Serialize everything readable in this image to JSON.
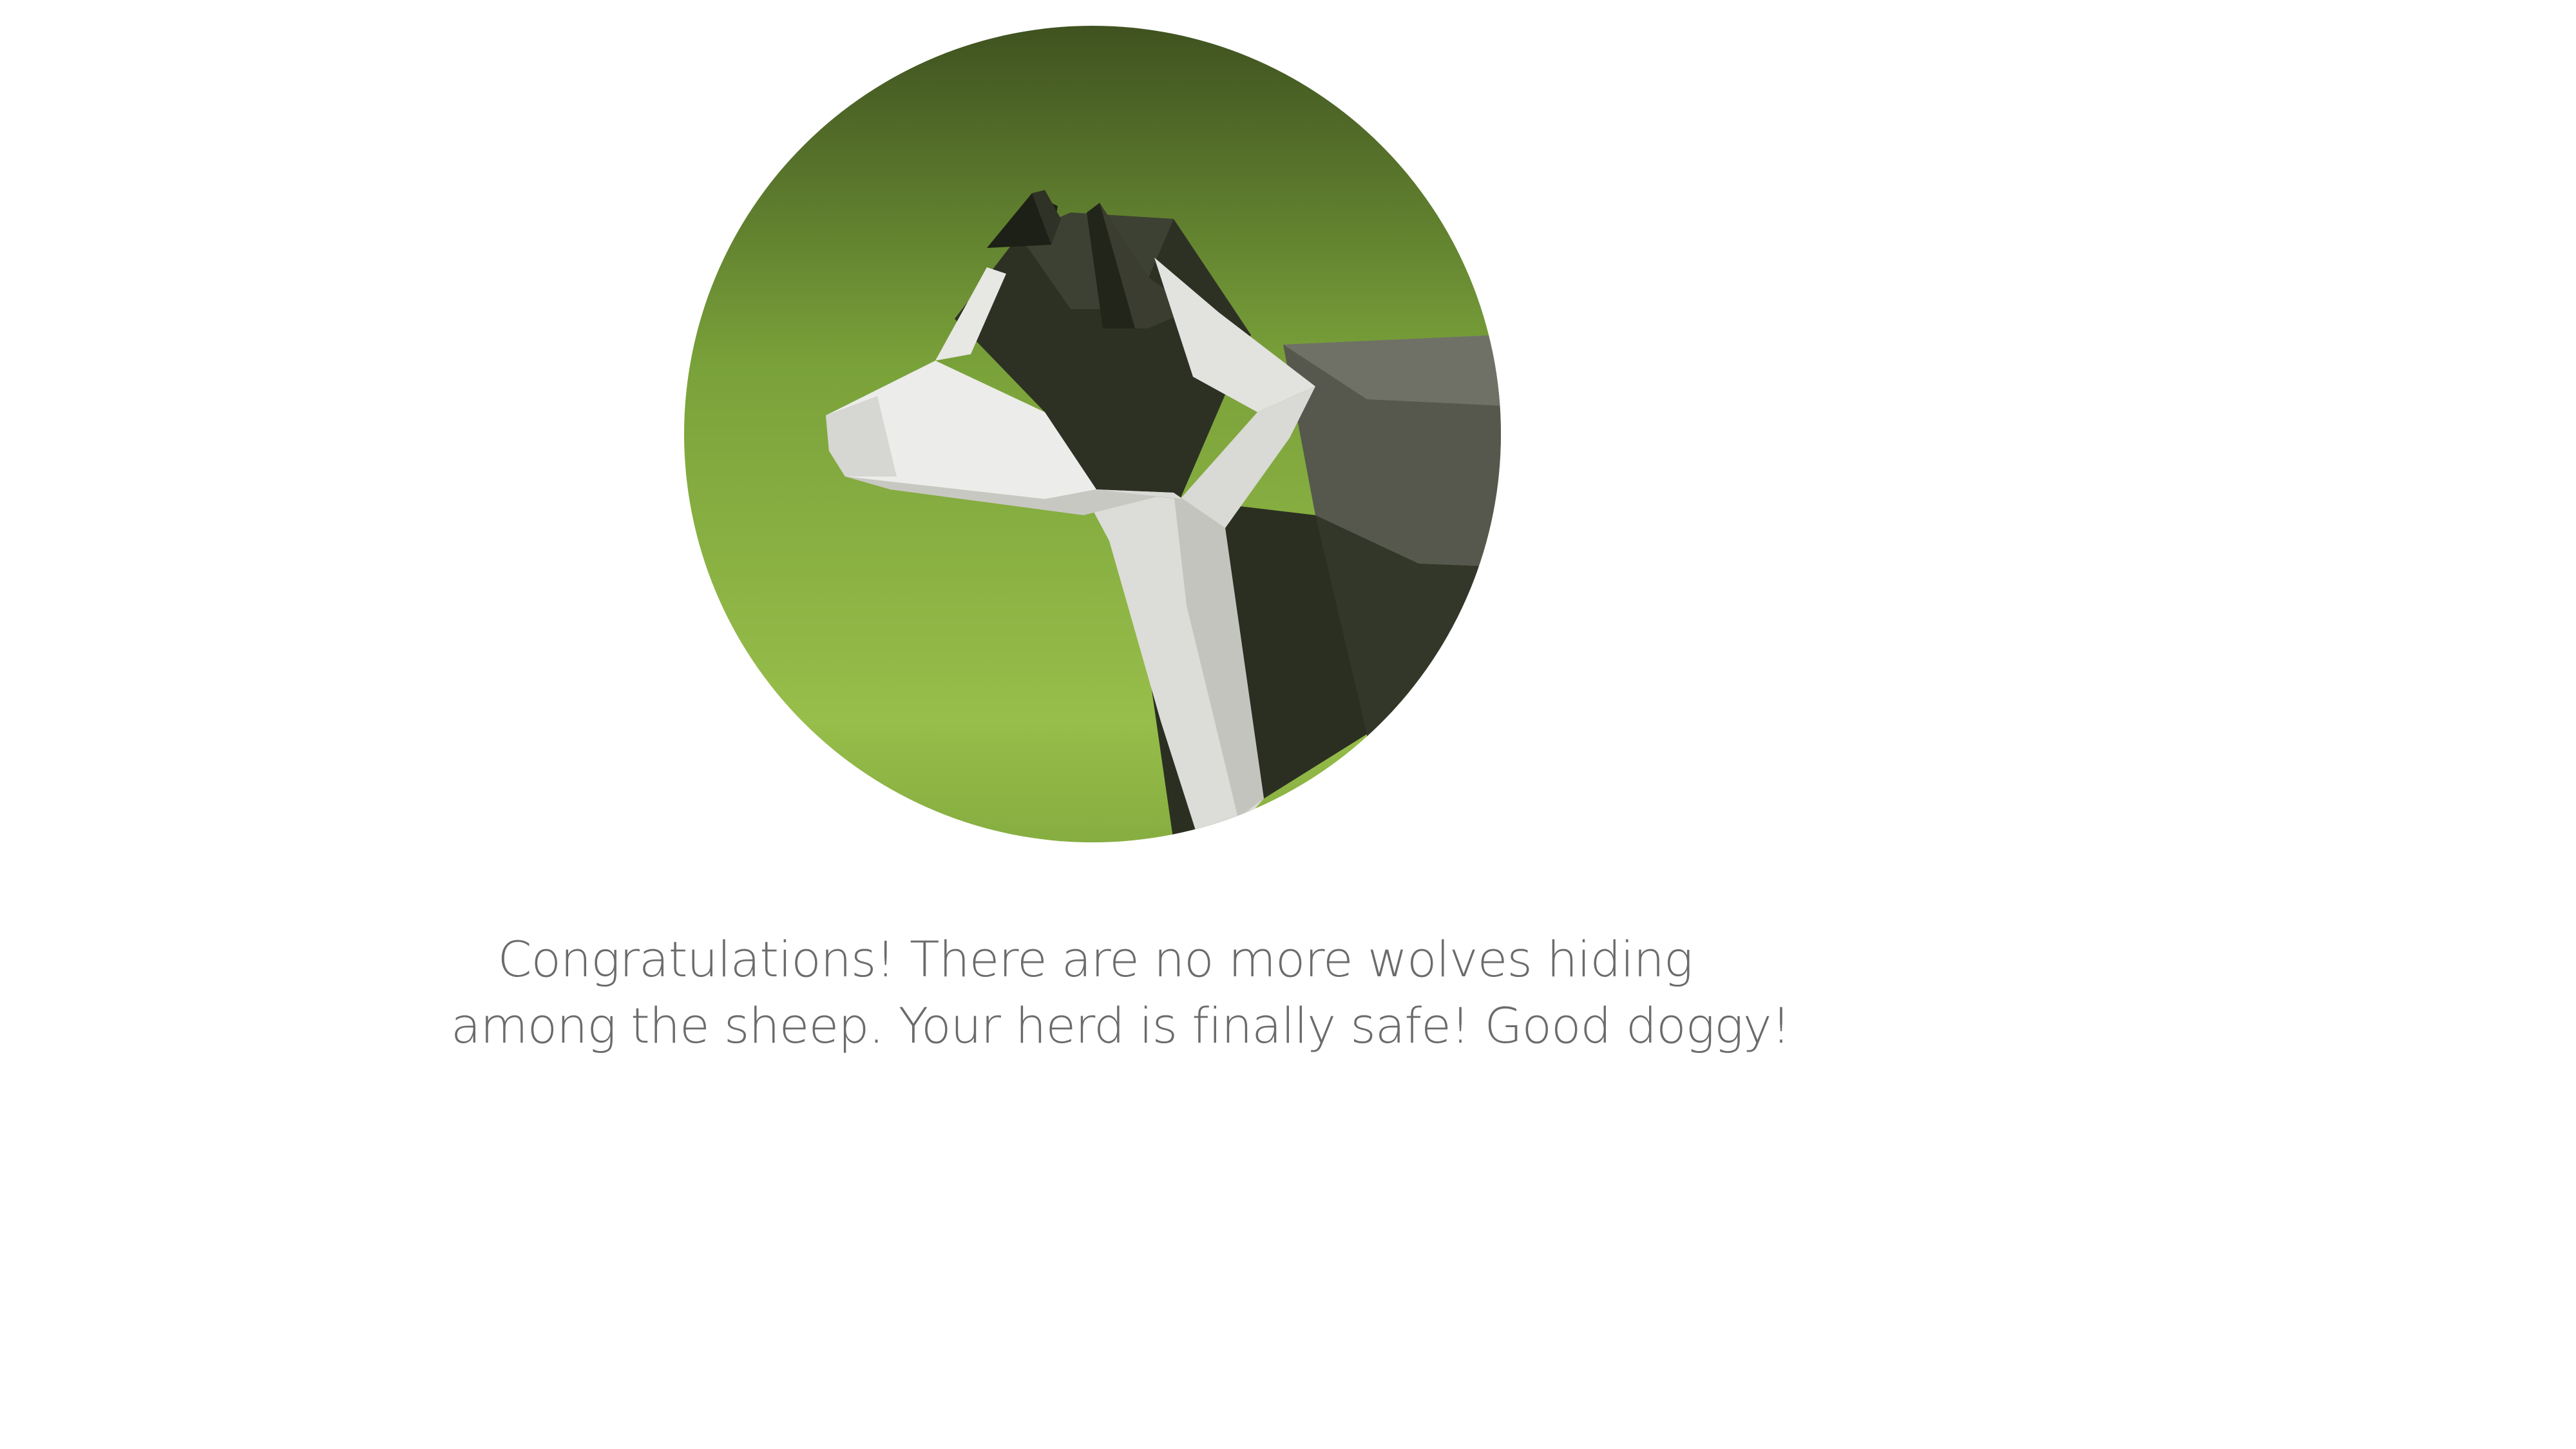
{
  "victory": {
    "illustration": {
      "icon": "sheepdog-portrait",
      "colors": {
        "background_top": "#3f5220",
        "background_mid": "#7aa23a",
        "background_bottom": "#97be4a",
        "fur_dark": "#2b2f22",
        "fur_mid": "#55574c",
        "fur_white": "#e7e7e4"
      }
    },
    "message": {
      "line1": "Congratulations! There are no more wolves hiding",
      "line2": "among the sheep. Your herd is finally safe! Good doggy!",
      "color": "#6b6b6b"
    }
  }
}
